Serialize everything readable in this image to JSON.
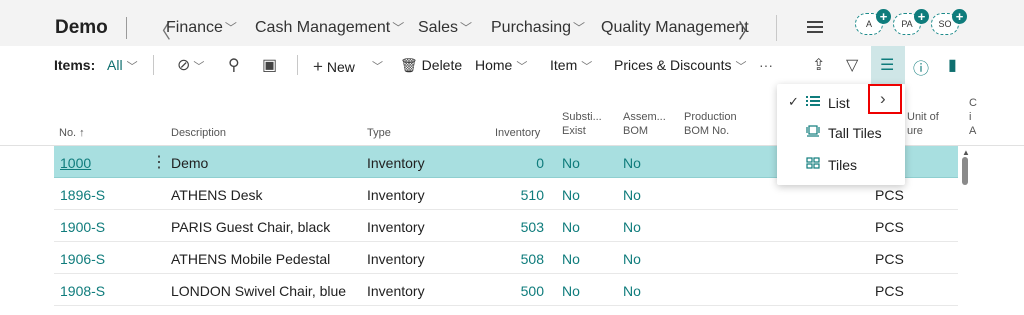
{
  "app": {
    "title": "Demo"
  },
  "nav": {
    "items": [
      {
        "label": "Finance"
      },
      {
        "label": "Cash Management"
      },
      {
        "label": "Sales"
      },
      {
        "label": "Purchasing"
      },
      {
        "label": "Quality Management"
      }
    ],
    "avatars": [
      {
        "label": "A"
      },
      {
        "label": "PA"
      },
      {
        "label": "SO"
      }
    ]
  },
  "actionbar": {
    "items_label": "Items:",
    "filter_value": "All",
    "new_label": "New",
    "delete_label": "Delete",
    "home_label": "Home",
    "item_label": "Item",
    "prices_label": "Prices & Discounts",
    "more_label": "···"
  },
  "table": {
    "headers": {
      "no": "No. ↑",
      "description": "Description",
      "type": "Type",
      "inventory": "Inventory",
      "subst_1": "Substi...",
      "subst_2": "Exist",
      "assem_1": "Assem...",
      "assem_2": "BOM",
      "prod_1": "Production",
      "prod_2": "BOM No.",
      "unit_1": "Unit of",
      "unit_2": "ure",
      "extra_1": "C",
      "extra_2": "i",
      "extra_3": "A"
    },
    "rows": [
      {
        "no": "1000",
        "description": "Demo",
        "type": "Inventory",
        "inventory": "0",
        "subst": "No",
        "assem": "No",
        "unit": ""
      },
      {
        "no": "1896-S",
        "description": "ATHENS Desk",
        "type": "Inventory",
        "inventory": "510",
        "subst": "No",
        "assem": "No",
        "unit": "PCS"
      },
      {
        "no": "1900-S",
        "description": "PARIS Guest Chair, black",
        "type": "Inventory",
        "inventory": "503",
        "subst": "No",
        "assem": "No",
        "unit": "PCS"
      },
      {
        "no": "1906-S",
        "description": "ATHENS Mobile Pedestal",
        "type": "Inventory",
        "inventory": "508",
        "subst": "No",
        "assem": "No",
        "unit": "PCS"
      },
      {
        "no": "1908-S",
        "description": "LONDON Swivel Chair, blue",
        "type": "Inventory",
        "inventory": "500",
        "subst": "No",
        "assem": "No",
        "unit": "PCS"
      }
    ]
  },
  "view_menu": {
    "items": [
      {
        "label": "List",
        "checked": true
      },
      {
        "label": "Tall Tiles",
        "checked": false
      },
      {
        "label": "Tiles",
        "checked": false
      }
    ]
  },
  "colors": {
    "accent": "#0f7c7c",
    "selected_row": "#a8dfe0",
    "highlight_box": "#e00000"
  }
}
